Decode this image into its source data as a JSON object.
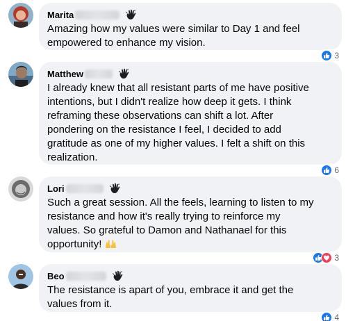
{
  "comments": [
    {
      "author": "Marita",
      "text": "Amazing how my values were similar to Day 1 and feel\nempowered to enhance my vision.",
      "reaction_count": "3"
    },
    {
      "author": "Matthew",
      "text": "I already knew that all resistant parts of me have positive\nintentions, but I didn't realize how deep it gets. I think\nreframing these observations can shift a lot. After\npondering on the resistance I feel, I decided to add\ngratitude as one of my higher values. I felt a shift on this\nrealization.",
      "reaction_count": "6"
    },
    {
      "author": "Lori",
      "text": "Such a great session. All the feels, learning to listen to my\nresistance and how it's really trying to reinforce my\nvalues. So grateful to Damon and Nathanael for this\nopportunity! ",
      "reaction_count": "3"
    },
    {
      "author": "Beo",
      "text": "The resistance is apart of you, embrace it and get the\nvalues from it.",
      "reaction_count": "4"
    }
  ],
  "colors": {
    "bubble": "#f0f2f5",
    "like": "#1877f2",
    "love": "#f33e58",
    "count": "#65676b"
  },
  "icons": {
    "badge": "waving-hand-icon",
    "like": "thumbs-up-icon",
    "love": "heart-icon",
    "emoji": "raising-hands-emoji"
  }
}
